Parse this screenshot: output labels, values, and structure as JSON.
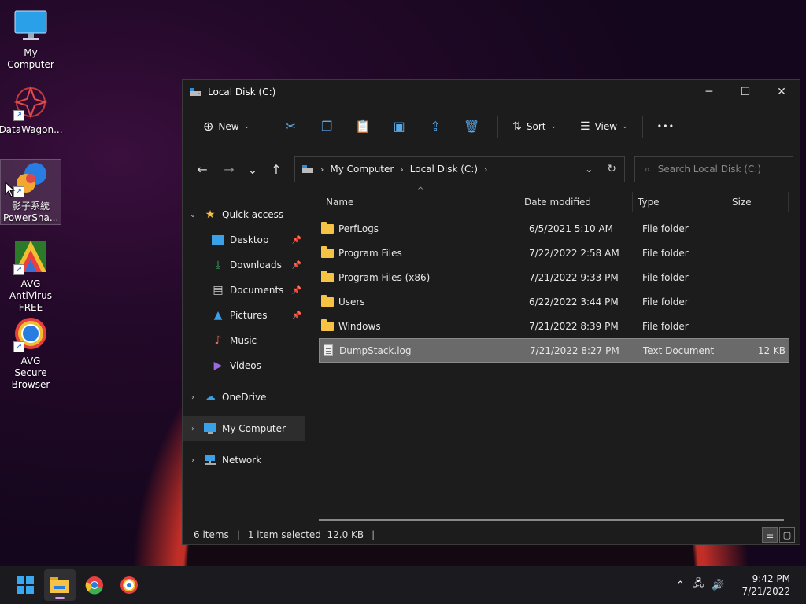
{
  "desktop": {
    "icons": [
      {
        "label": "My Computer"
      },
      {
        "label": "DataWagon..."
      },
      {
        "label": "影子系統 PowerSha..."
      },
      {
        "label": "AVG AntiVirus FREE"
      },
      {
        "label": "AVG Secure Browser"
      }
    ]
  },
  "window": {
    "title": "Local Disk (C:)",
    "controls": {
      "minimize": "─",
      "maximize": "☐",
      "close": "✕"
    }
  },
  "toolbar": {
    "new_label": "New",
    "sort_label": "Sort",
    "view_label": "View",
    "more_label": "•••"
  },
  "nav": {
    "back": "←",
    "forward": "→",
    "recent": "⌄",
    "up": "↑",
    "breadcrumb": [
      "My Computer",
      "Local Disk (C:)"
    ],
    "search_placeholder": "Search Local Disk (C:)"
  },
  "sidebar": {
    "quick_access": "Quick access",
    "items": [
      {
        "label": "Desktop",
        "pinned": true
      },
      {
        "label": "Downloads",
        "pinned": true
      },
      {
        "label": "Documents",
        "pinned": true
      },
      {
        "label": "Pictures",
        "pinned": true
      },
      {
        "label": "Music",
        "pinned": false
      },
      {
        "label": "Videos",
        "pinned": false
      }
    ],
    "onedrive": "OneDrive",
    "my_computer": "My Computer",
    "network": "Network"
  },
  "columns": {
    "name": "Name",
    "date": "Date modified",
    "type": "Type",
    "size": "Size"
  },
  "files": [
    {
      "name": "PerfLogs",
      "date": "6/5/2021 5:10 AM",
      "type": "File folder",
      "size": "",
      "kind": "folder"
    },
    {
      "name": "Program Files",
      "date": "7/22/2022 2:58 AM",
      "type": "File folder",
      "size": "",
      "kind": "folder"
    },
    {
      "name": "Program Files (x86)",
      "date": "7/21/2022 9:33 PM",
      "type": "File folder",
      "size": "",
      "kind": "folder"
    },
    {
      "name": "Users",
      "date": "6/22/2022 3:44 PM",
      "type": "File folder",
      "size": "",
      "kind": "folder"
    },
    {
      "name": "Windows",
      "date": "7/21/2022 8:39 PM",
      "type": "File folder",
      "size": "",
      "kind": "folder"
    },
    {
      "name": "DumpStack.log",
      "date": "7/21/2022 8:27 PM",
      "type": "Text Document",
      "size": "12 KB",
      "kind": "document",
      "selected": true
    }
  ],
  "status": {
    "count": "6 items",
    "selection": "1 item selected  12.0 KB"
  },
  "taskbar": {
    "time": "9:42 PM",
    "date": "7/21/2022"
  },
  "colors": {
    "accent": "#5aa7e6",
    "folder": "#f6c344",
    "selected_row": "#6a6a6a"
  }
}
